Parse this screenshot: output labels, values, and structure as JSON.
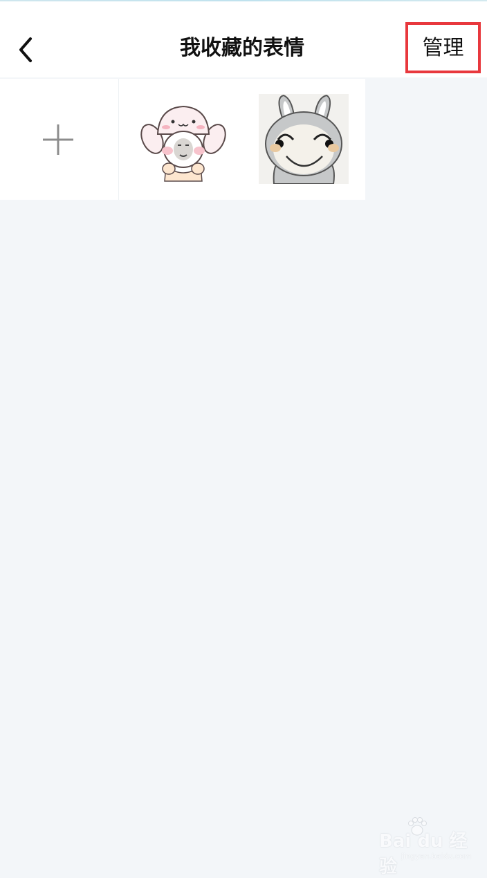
{
  "header": {
    "title": "我收藏的表情",
    "manage_label": "管理",
    "back_icon": "chevron-left-icon",
    "highlight_color": "#e8383d"
  },
  "stickers": {
    "add_icon": "plus-icon",
    "items": [
      {
        "name": "bunny-hat-meme-face-sticker"
      },
      {
        "name": "grey-bunny-smiling-sticker"
      }
    ]
  },
  "watermark": {
    "brand": "Bai du 经验",
    "url": "jingyan.baidu.com"
  },
  "colors": {
    "background": "#f3f6f9",
    "header_bg": "#ffffff",
    "text": "#111111"
  }
}
